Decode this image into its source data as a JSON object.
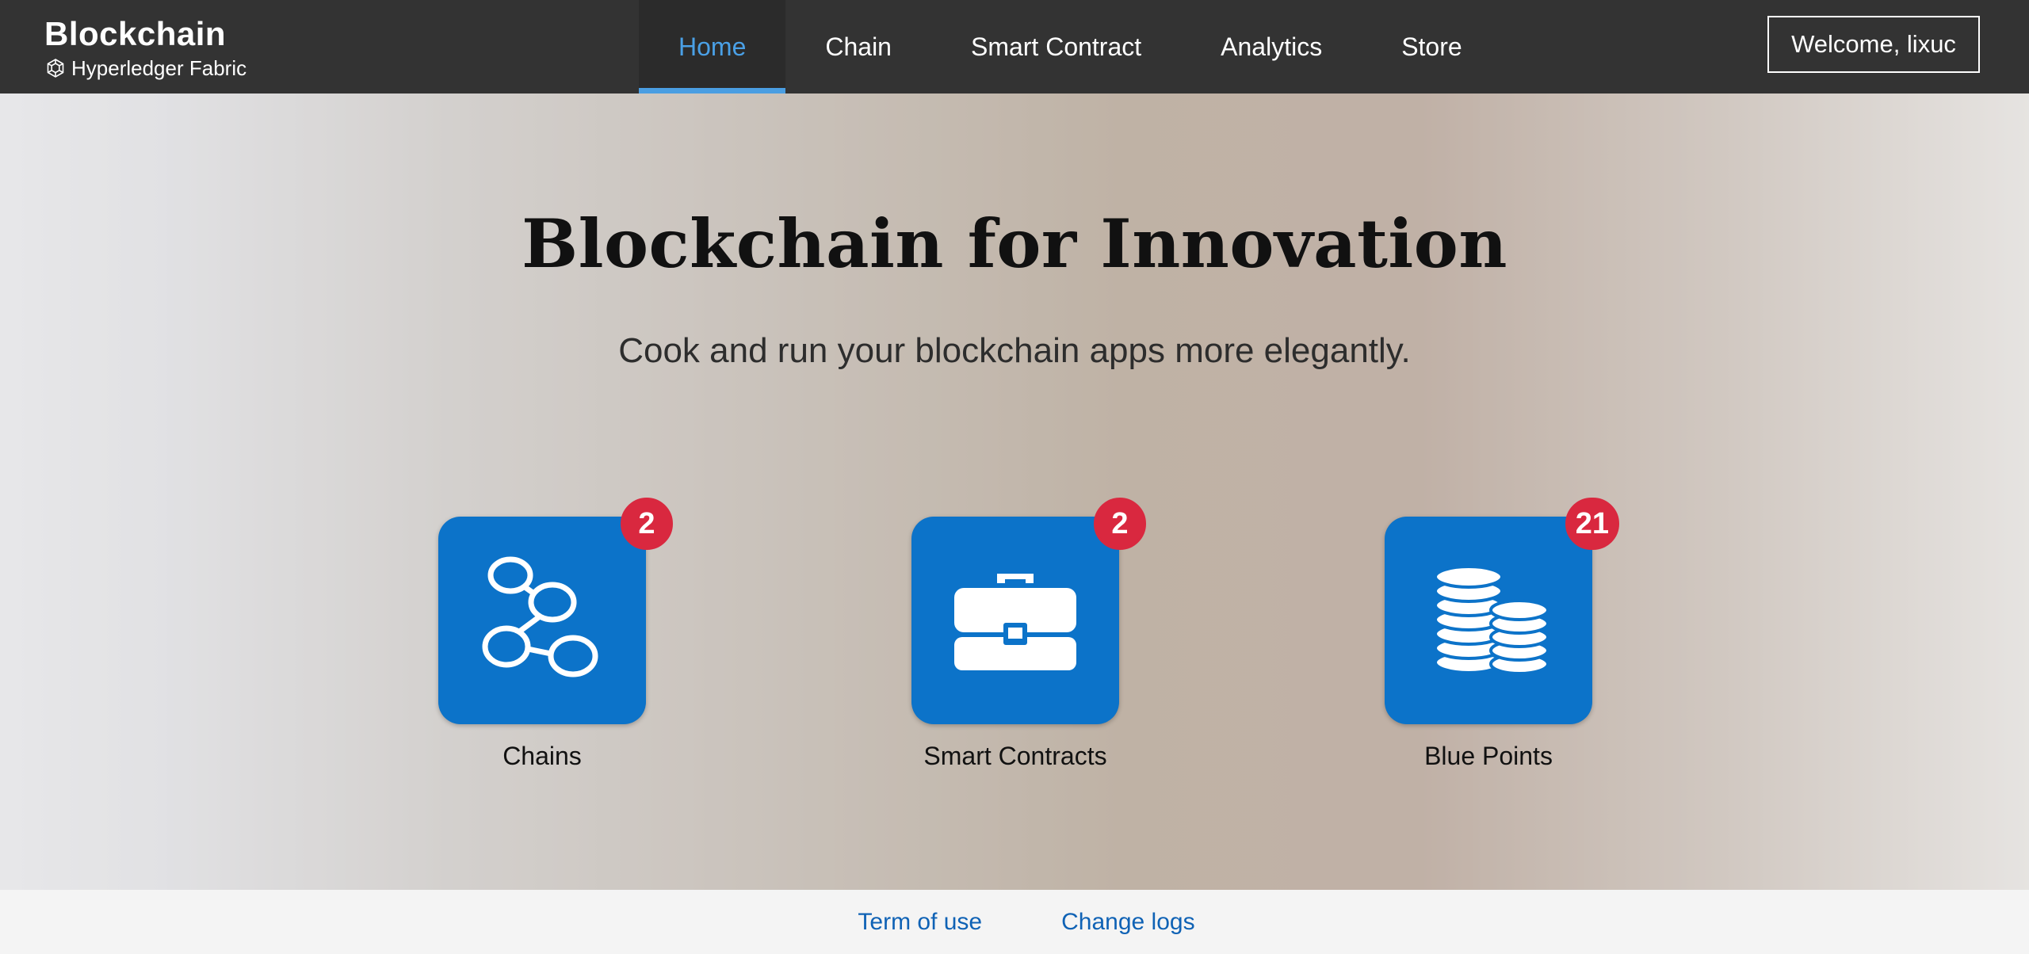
{
  "brand": {
    "title": "Blockchain",
    "subtitle": "Hyperledger Fabric",
    "logo_icon": "hyperledger-logo-icon"
  },
  "nav": {
    "items": [
      {
        "label": "Home",
        "active": true
      },
      {
        "label": "Chain",
        "active": false
      },
      {
        "label": "Smart Contract",
        "active": false
      },
      {
        "label": "Analytics",
        "active": false
      },
      {
        "label": "Store",
        "active": false
      }
    ],
    "active_color": "#4a9ee2"
  },
  "user": {
    "welcome": "Welcome, lixuc"
  },
  "hero": {
    "title": "Blockchain for Innovation",
    "subtitle": "Cook and run your blockchain apps more elegantly."
  },
  "tiles": [
    {
      "label": "Chains",
      "count": "2",
      "icon": "chain-nodes-icon"
    },
    {
      "label": "Smart Contracts",
      "count": "2",
      "icon": "briefcase-icon"
    },
    {
      "label": "Blue Points",
      "count": "21",
      "icon": "coins-stack-icon"
    }
  ],
  "footer": {
    "links": [
      "Term of use",
      "Change logs"
    ]
  },
  "colors": {
    "topbar": "#333333",
    "tile": "#0c73c9",
    "badge": "#d9283f",
    "link": "#0f62b5"
  }
}
